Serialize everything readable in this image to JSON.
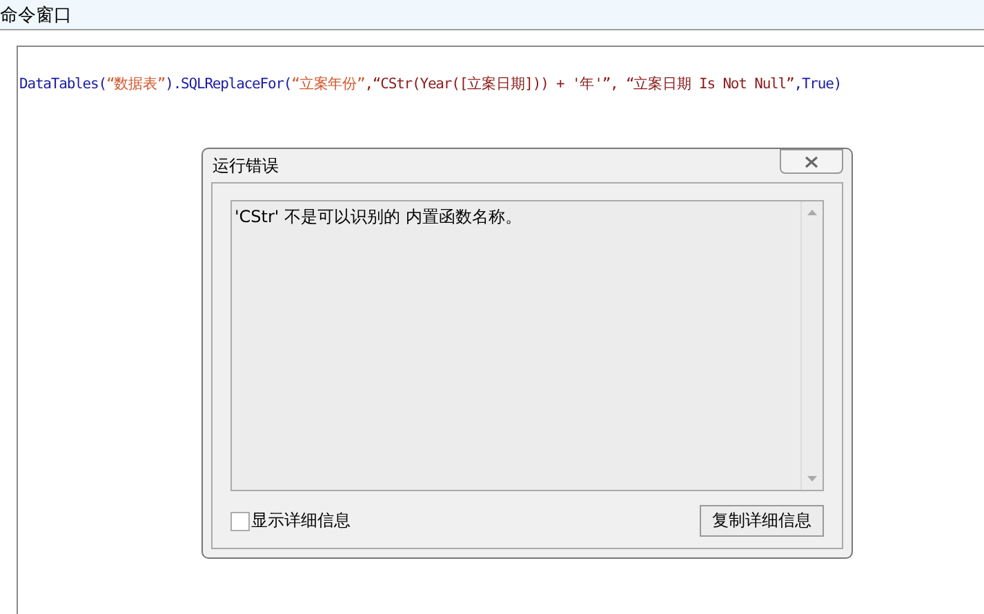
{
  "window": {
    "title": "命令窗口"
  },
  "code_line": [
    {
      "kind": "ident",
      "text": "DataTables("
    },
    {
      "kind": "string",
      "text": "“数据表”"
    },
    {
      "kind": "ident",
      "text": ").SQLReplaceFor("
    },
    {
      "kind": "string",
      "text": "“立案年份”"
    },
    {
      "kind": "expr",
      "text": ",“CStr(Year([立案日期])) + '年'”, “立案日期 Is Not Null”"
    },
    {
      "kind": "ident",
      "text": ",True)"
    }
  ],
  "dialog": {
    "title": "运行错误",
    "message": "'CStr' 不是可以识别的 内置函数名称。",
    "show_details": {
      "label": "显示详细信息",
      "checked": false
    },
    "copy_button": "复制详细信息"
  }
}
